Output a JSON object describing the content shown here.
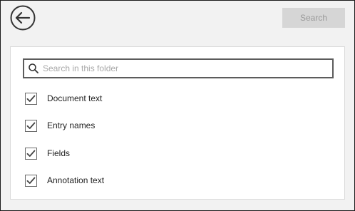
{
  "header": {
    "back_icon": "arrow-left-circle-icon",
    "search_button_label": "Search"
  },
  "search": {
    "placeholder": "Search in this folder",
    "value": "",
    "icon": "search-icon"
  },
  "options": [
    {
      "label": "Document text",
      "checked": true
    },
    {
      "label": "Entry names",
      "checked": true
    },
    {
      "label": "Fields",
      "checked": true
    },
    {
      "label": "Annotation text",
      "checked": true
    }
  ],
  "colors": {
    "window_background": "#f2f2f2",
    "panel_background": "#ffffff",
    "disabled_button": "#d6d6d6",
    "checkmark": "#444444"
  }
}
